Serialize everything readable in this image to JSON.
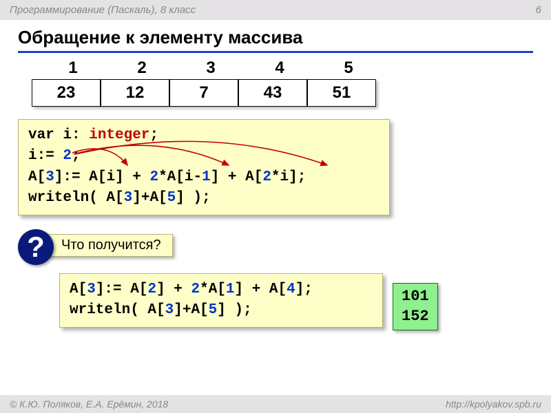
{
  "header": {
    "course": "Программирование (Паскаль), 8 класс",
    "page": "6"
  },
  "title": "Обращение к элементу массива",
  "array": {
    "indices": [
      "1",
      "2",
      "3",
      "4",
      "5"
    ],
    "values": [
      "23",
      "12",
      "7",
      "43",
      "51"
    ]
  },
  "code1": {
    "l1_a": "var i: ",
    "l1_b": "integer",
    "l1_c": ";",
    "l2_a": "i:= ",
    "l2_b": "2",
    "l2_c": ";",
    "l3_a": "A[",
    "l3_b": "3",
    "l3_c": "]:= A[i] + ",
    "l3_d": "2",
    "l3_e": "*A[i-",
    "l3_f": "1",
    "l3_g": "] + A[",
    "l3_h": "2",
    "l3_i": "*i];",
    "l4_a": "writeln( A[",
    "l4_b": "3",
    "l4_c": "]+A[",
    "l4_d": "5",
    "l4_e": "] );"
  },
  "question": {
    "mark": "?",
    "label": "Что получится?"
  },
  "code2": {
    "l1_a": "A[",
    "l1_b": "3",
    "l1_c": "]:= A[",
    "l1_d": "2",
    "l1_e": "] + ",
    "l1_f": "2",
    "l1_g": "*A[",
    "l1_h": "1",
    "l1_i": "] + A[",
    "l1_j": "4",
    "l1_k": "];",
    "l2_a": "writeln( A[",
    "l2_b": "3",
    "l2_c": "]+A[",
    "l2_d": "5",
    "l2_e": "] );"
  },
  "results": {
    "r1": "101",
    "r2": "152"
  },
  "footer": {
    "copyright": "© К.Ю. Поляков, Е.А. Ерёмин, 2018",
    "url": "http://kpolyakov.spb.ru"
  }
}
